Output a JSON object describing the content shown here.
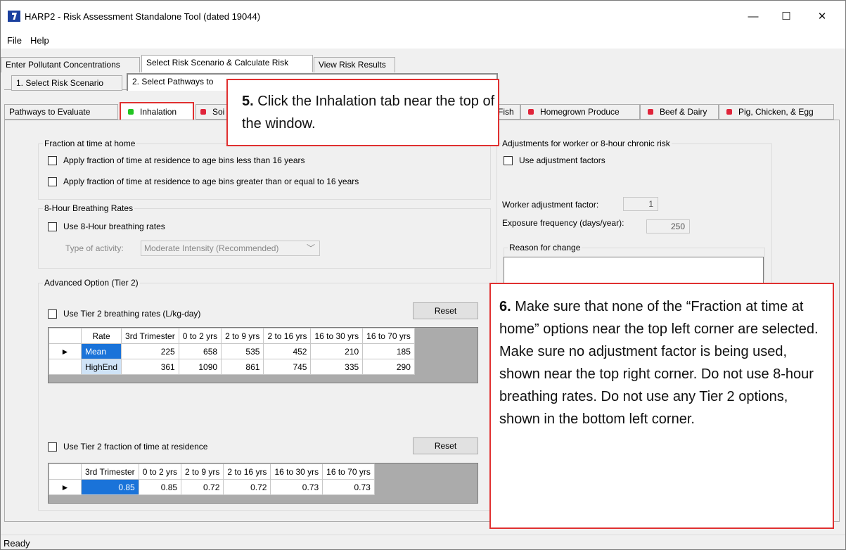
{
  "window": {
    "title": "HARP2 - Risk Assessment Standalone Tool (dated 19044)",
    "minimize": "—",
    "maximize": "☐",
    "close": "✕"
  },
  "menu": [
    "File",
    "Help"
  ],
  "main_tabs": [
    "Enter Pollutant Concentrations",
    "Select Risk Scenario & Calculate Risk",
    "View Risk Results"
  ],
  "sub_tabs": [
    "1. Select Risk Scenario",
    "2. Select Pathways to"
  ],
  "pathway_tabs": [
    {
      "label": "Pathways to Evaluate"
    },
    {
      "label": "Inhalation",
      "status": "green"
    },
    {
      "label": "Soi",
      "status": "red"
    },
    {
      "label": "Fish",
      "status": "none"
    },
    {
      "label": "Homegrown Produce",
      "status": "red"
    },
    {
      "label": "Beef & Dairy",
      "status": "red"
    },
    {
      "label": "Pig, Chicken, & Egg",
      "status": "red"
    }
  ],
  "colors": {
    "green": "#22c522",
    "red": "#e0243a",
    "callout_border": "#e03030",
    "selection": "#1a73d9"
  },
  "fraction_home": {
    "title": "Fraction at time at home",
    "options": [
      "Apply fraction of time at residence to age bins less than 16 years",
      "Apply fraction of time at residence to age bins greater than or equal to 16 years"
    ]
  },
  "breathing": {
    "title": "8-Hour Breathing Rates",
    "use_label": "Use 8-Hour breathing rates",
    "activity_label": "Type of activity:",
    "activity_value": "Moderate Intensity (Recommended)"
  },
  "tier2": {
    "title": "Advanced Option (Tier 2)",
    "breathing_label": "Use Tier 2 breathing rates (L/kg-day)",
    "reset_label": "Reset",
    "rates_headers": [
      "Rate",
      "3rd Trimester",
      "0 to 2 yrs",
      "2 to 9 yrs",
      "2 to 16 yrs",
      "16 to 30 yrs",
      "16 to 70 yrs"
    ],
    "rates_rows": [
      {
        "name": "Mean",
        "values": [
          "225",
          "658",
          "535",
          "452",
          "210",
          "185"
        ]
      },
      {
        "name": "HighEnd",
        "values": [
          "361",
          "1090",
          "861",
          "745",
          "335",
          "290"
        ]
      }
    ],
    "fraction_label": "Use Tier 2 fraction of time at residence",
    "fraction_headers": [
      "3rd Trimester",
      "0 to 2 yrs",
      "2 to 9 yrs",
      "2 to 16 yrs",
      "16 to 30 yrs",
      "16 to 70 yrs"
    ],
    "fraction_values": [
      "0.85",
      "0.85",
      "0.72",
      "0.72",
      "0.73",
      "0.73"
    ]
  },
  "worker": {
    "title": "Adjustments for worker or 8-hour chronic risk",
    "use_label": "Use adjustment factors",
    "factor_label": "Worker adjustment factor:",
    "factor_value": "1",
    "freq_label": "Exposure frequency (days/year):",
    "freq_value": "250",
    "reason_label": "Reason for change"
  },
  "callout5": {
    "number": "5.",
    "text": "Click the Inhalation tab near the top of the window."
  },
  "callout6": {
    "number": "6.",
    "text": "Make sure that none of the “Fraction at time at home” options near the top left corner are selected. Make sure no adjustment factor is being used, shown near the top right corner.  Do not use 8-hour breathing rates.  Do not use any Tier 2 options, shown in the bottom left corner."
  },
  "status": "Ready"
}
